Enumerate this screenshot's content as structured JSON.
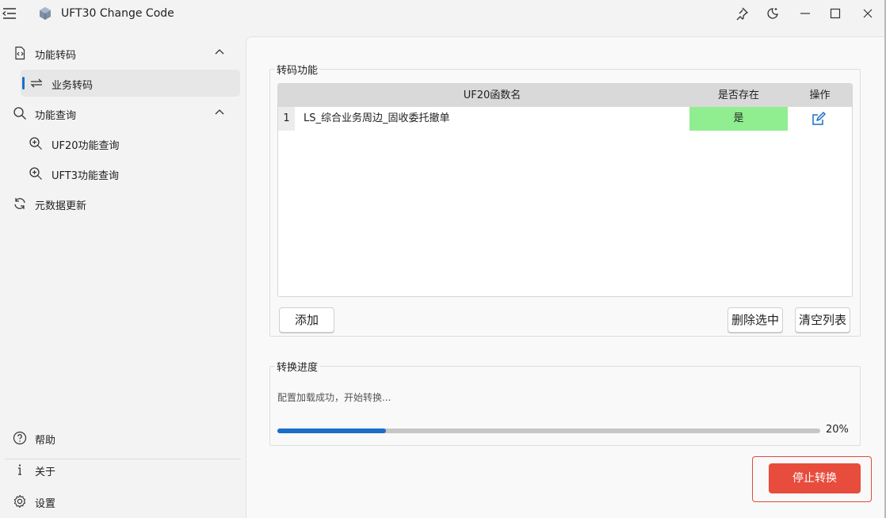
{
  "app": {
    "title": "UFT30 Change Code"
  },
  "sidebar": {
    "items": [
      {
        "label": "功能转码",
        "icon": "code-file-icon",
        "expanded": true
      },
      {
        "label": "业务转码",
        "icon": "swap-arrows-icon",
        "selected": true
      },
      {
        "label": "功能查询",
        "icon": "search-icon",
        "expanded": true
      },
      {
        "label": "UF20功能查询",
        "icon": "zoom-in-icon"
      },
      {
        "label": "UFT3功能查询",
        "icon": "zoom-in-icon"
      },
      {
        "label": "元数据更新",
        "icon": "refresh-icon"
      }
    ],
    "footer": [
      {
        "label": "帮助",
        "icon": "help-icon"
      },
      {
        "label": "关于",
        "icon": "info-icon"
      },
      {
        "label": "设置",
        "icon": "gear-icon"
      }
    ]
  },
  "convert_group": {
    "title": "转码功能",
    "columns": [
      "UF20函数名",
      "是否存在",
      "操作"
    ],
    "rows": [
      {
        "num": "1",
        "name": "LS_综合业务周边_固收委托撤单",
        "exists": "是"
      }
    ],
    "add_label": "添加",
    "delete_label": "删除选中",
    "clear_label": "清空列表"
  },
  "progress_group": {
    "title": "转换进度",
    "status": "配置加载成功，开始转换...",
    "value": 20,
    "percent_label": "20%"
  },
  "stop_label": "停止转换",
  "colors": {
    "accent": "#1a6ec8",
    "exists_bg": "#90ee90",
    "stop_bg": "#e74c3c"
  }
}
